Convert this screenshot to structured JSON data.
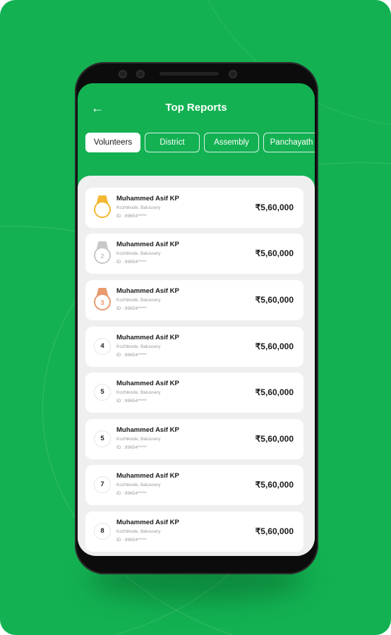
{
  "header": {
    "title": "Top Reports"
  },
  "tabs": [
    {
      "label": "Volunteers",
      "active": true
    },
    {
      "label": "District",
      "active": false
    },
    {
      "label": "Assembly",
      "active": false
    },
    {
      "label": "Panchayath",
      "active": false
    }
  ],
  "colors": {
    "brand_green": "#13b152",
    "gold": "#f4b731",
    "silver": "#c8c8c8",
    "bronze": "#e99a6f"
  },
  "reports": [
    {
      "rank": "",
      "medal": "gold",
      "name": "Muhammed Asif KP",
      "location": "Kozhikode, Balussery",
      "id": "ID : 89654*****",
      "amount": "₹5,60,000"
    },
    {
      "rank": "2",
      "medal": "silver",
      "name": "Muhammed Asif KP",
      "location": "Kozhikode, Balussery",
      "id": "ID : 89654*****",
      "amount": "₹5,60,000"
    },
    {
      "rank": "3",
      "medal": "bronze",
      "name": "Muhammed Asif KP",
      "location": "Kozhikode, Balussery",
      "id": "ID : 89654*****",
      "amount": "₹5,60,000"
    },
    {
      "rank": "4",
      "medal": "",
      "name": "Muhammed Asif KP",
      "location": "Kozhikode, Balussery",
      "id": "ID : 89654*****",
      "amount": "₹5,60,000"
    },
    {
      "rank": "5",
      "medal": "",
      "name": "Muhammed Asif KP",
      "location": "Kozhikode, Balussery",
      "id": "ID : 89654*****",
      "amount": "₹5,60,000"
    },
    {
      "rank": "5",
      "medal": "",
      "name": "Muhammed Asif KP",
      "location": "Kozhikode, Balussery",
      "id": "ID : 89654*****",
      "amount": "₹5,60,000"
    },
    {
      "rank": "7",
      "medal": "",
      "name": "Muhammed Asif KP",
      "location": "Kozhikode, Balussery",
      "id": "ID : 89654*****",
      "amount": "₹5,60,000"
    },
    {
      "rank": "8",
      "medal": "",
      "name": "Muhammed Asif KP",
      "location": "Kozhikode, Balussery",
      "id": "ID : 89654*****",
      "amount": "₹5,60,000"
    }
  ]
}
